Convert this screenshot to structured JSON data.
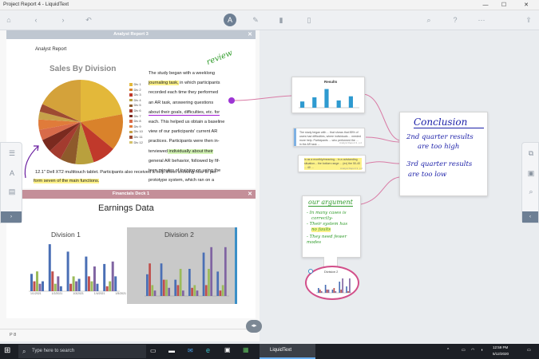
{
  "window": {
    "title": "Project Report 4 - LiquidText",
    "minimize": "—",
    "maximize": "☐",
    "close": "✕"
  },
  "doc1": {
    "header": "Analyst Report 3",
    "label": "Analyst Report",
    "chart_title": "Sales By Division",
    "legend": [
      "Div 1",
      "Div 2",
      "Div 3",
      "Div 4",
      "Div 5",
      "Div 6",
      "Div 7",
      "Div 8",
      "Div 9",
      "Div 10",
      "Div 11",
      "Div 12"
    ],
    "legend_colors": [
      "#e3b83a",
      "#d9822b",
      "#c0392b",
      "#b9a03d",
      "#8e5a2b",
      "#a33b2f",
      "#7a2a1f",
      "#d86b4a",
      "#e07b3a",
      "#c7a24a",
      "#9e4b32",
      "#d4c16b"
    ],
    "text_lines": [
      "The study began with a weeklong",
      "journaling task,",
      " in which participants",
      "recorded each time they performed",
      "an AR task, answering questions",
      "about their goals, difficulties, etc. for",
      "each. This helped us obtain a baseline",
      "view of our participants' current AR",
      "practices. Participants were then in-",
      "terviewed",
      " individually about their",
      "general AR behavior, followed by fif-",
      "teen minutes of training on using the",
      "prototype system, which ran on a"
    ],
    "line2": "12.1\" Dell XT2 multitouch tablet. Participants also received a help sheet showing how to per-",
    "line3_hl": "form seven of the main functions.",
    "annotation": "review"
  },
  "doc2": {
    "header": "Financials Deck 1",
    "title": "Earnings Data",
    "div1": "Division 1",
    "div2": "Division 2",
    "div1_x": [
      "1/1/2021",
      "1/2/2021",
      "1/3/2021",
      "1/4/2021",
      "1/5/2021"
    ],
    "div2_y": [
      "180",
      "160",
      "140",
      "120",
      "100",
      "80",
      "60",
      "40",
      "20",
      "0"
    ]
  },
  "workspace": {
    "results_title": "Results",
    "excerpt1": "The study began with ... that shows that 85% of users had difficulties, where individuals ... needed more help. Participants ... who performed the ... in the AR task ...",
    "excerpt1_src": "Analyst Report 3, p 2",
    "excerpt2": "in as a monthly/meaning... in a outstanding situation... the bottom range ... (ex) the 50-40 ... 40 ...",
    "excerpt2_src": "Analyst Report 3, p 2",
    "conclusion": {
      "title": "Conclusion",
      "line1": "2nd quarter results",
      "line2": "are too high",
      "line3": "3rd quarter results",
      "line4": "are too low"
    },
    "argument": {
      "title": "our argument",
      "b1a": "- In many cases is",
      "b1b": "correctly-",
      "b2a": "- Their system has",
      "b2b": "no faults",
      "b3": "- They need fewer modes"
    },
    "mini_chart": "Division 2"
  },
  "status": {
    "page": "P 8"
  },
  "taskbar": {
    "search_placeholder": "Type here to search",
    "app": "LiquidText",
    "time": "12:59 PM",
    "date": "5/12/2020"
  },
  "pie": {
    "values": [
      22,
      14,
      9,
      7,
      6,
      5,
      5,
      4,
      4,
      3,
      3,
      18
    ],
    "colors": [
      "#e3b83a",
      "#d9822b",
      "#c0392b",
      "#b9a03d",
      "#8e5a2b",
      "#a33b2f",
      "#7a2a1f",
      "#d86b4a",
      "#e07b3a",
      "#c7a24a",
      "#9e4b32",
      "#d4a23a"
    ]
  }
}
